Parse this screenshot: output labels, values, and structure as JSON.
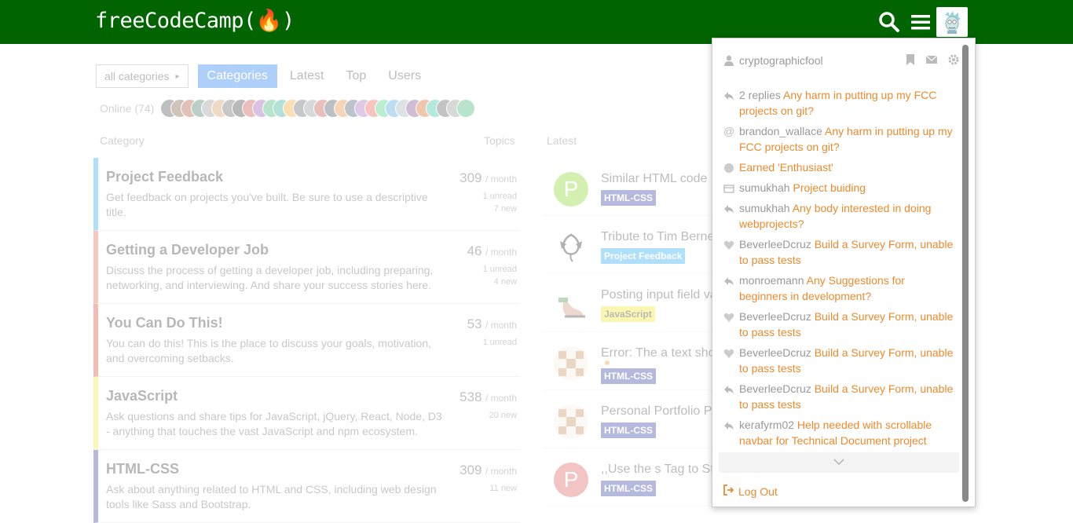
{
  "header": {
    "logo": "freeCodeCamp(🔥)",
    "bg_color": "#006400"
  },
  "nav": {
    "category_dropdown": "all categories",
    "pills": [
      {
        "label": "Categories",
        "active": true
      },
      {
        "label": "Latest",
        "active": false
      },
      {
        "label": "Top",
        "active": false
      },
      {
        "label": "Users",
        "active": false
      }
    ],
    "online_label": "Online (74)"
  },
  "columns": {
    "category": "Category",
    "topics": "Topics",
    "latest": "Latest"
  },
  "categories": [
    {
      "name": "Project Feedback",
      "desc": "Get feedback on projects you've built. Be sure to use a descriptive title.",
      "count": "309",
      "period": "/ month",
      "sub1": "1 unread",
      "sub2": "7 new",
      "color": "#0a6ef4"
    },
    {
      "name": "Getting a Developer Job",
      "desc": "Discuss the process of getting a developer job, including preparing, networking, and interviewing. And share your success stories here.",
      "count": "46",
      "period": "/ month",
      "sub1": "1 unread",
      "sub2": "4 new",
      "color": "#e45735"
    },
    {
      "name": "You Can Do This!",
      "desc": "You can do this! This is the place to discuss your goals, motivation, and overcoming setbacks.",
      "count": "53",
      "period": "/ month",
      "sub1": "1 unread",
      "sub2": "",
      "color": "#e02d18"
    },
    {
      "name": "JavaScript",
      "desc": "Ask questions and share tips for JavaScript, jQuery, React, Node, D3 - anything that touches the vast JavaScript and npm ecosystem.",
      "count": "538",
      "period": "/ month",
      "sub1": "20 new",
      "sub2": "",
      "color": "#f3e813"
    },
    {
      "name": "HTML-CSS",
      "desc": "Ask about anything related to HTML and CSS, including web design tools like Sass and Bootstrap.",
      "count": "309",
      "period": "/ month",
      "sub1": "11 new",
      "sub2": "",
      "color": "#1e2a9c"
    }
  ],
  "latest": [
    {
      "title": "Similar HTML code",
      "tag": "HTML-CSS",
      "tag_color": "#1e2a9c",
      "avatar_letter": "P",
      "avatar_color": "#79d10c"
    },
    {
      "title": "Tribute to Tim Berne",
      "tag": "Project Feedback",
      "tag_color": "#0a9ff0",
      "avatar_letter": "",
      "avatar_color": "#222222"
    },
    {
      "title": "Posting input field va",
      "tag": "JavaScript",
      "tag_color": "#f3e813",
      "avatar_letter": "",
      "avatar_color": "#c8876b"
    },
    {
      "title": "Error: The a text sho",
      "tag": "HTML-CSS",
      "tag_color": "#1e2a9c",
      "avatar_letter": "",
      "avatar_color": "#c4834b"
    },
    {
      "title": "Personal Portfolio P",
      "tag": "HTML-CSS",
      "tag_color": "#1e2a9c",
      "avatar_letter": "",
      "avatar_color": "#c4834b"
    },
    {
      "title": ",,Use the s Tag to St",
      "tag": "HTML-CSS",
      "tag_color": "#1e2a9c",
      "avatar_letter": "P",
      "avatar_color": "#d94c4c"
    }
  ],
  "panel": {
    "username": "cryptographicfool",
    "notifications": [
      {
        "icon": "reply-icon",
        "user": "2 replies",
        "text": "Any harm in putting up my FCC projects on git?"
      },
      {
        "icon": "mention-icon",
        "user": "brandon_wallace",
        "text": "Any harm in putting up my FCC projects on git?"
      },
      {
        "icon": "badge-icon",
        "user": "",
        "text": "Earned 'Enthusiast'"
      },
      {
        "icon": "message-icon",
        "user": "sumukhah",
        "text": "Project buiding"
      },
      {
        "icon": "reply-icon",
        "user": "sumukhah",
        "text": "Any body interested in doing webprojects?"
      },
      {
        "icon": "heart-icon",
        "user": "BeverleeDcruz",
        "text": "Build a Survey Form, unable to pass tests"
      },
      {
        "icon": "reply-icon",
        "user": "monroemann",
        "text": "Any Suggestions for beginners in development?"
      },
      {
        "icon": "heart-icon",
        "user": "BeverleeDcruz",
        "text": "Build a Survey Form, unable to pass tests"
      },
      {
        "icon": "heart-icon",
        "user": "BeverleeDcruz",
        "text": "Build a Survey Form, unable to pass tests"
      },
      {
        "icon": "reply-icon",
        "user": "BeverleeDcruz",
        "text": "Build a Survey Form, unable to pass tests"
      },
      {
        "icon": "reply-icon",
        "user": "kerafyrm02",
        "text": "Help needed with scrollable navbar for Technical Document project"
      }
    ],
    "logout_label": "Log Out",
    "link_color": "#ec8a2d"
  },
  "online_avatar_colors": [
    "#3a3a3a",
    "#6b4c2a",
    "#a04020",
    "#2d6a4f",
    "#8a8a8a",
    "#d18a4a",
    "#555",
    "#2a2a2a",
    "#c0392b",
    "#8e44ad",
    "#27ae60",
    "#16a085",
    "#f39c12",
    "#555",
    "#7f8c8d",
    "#c0392b",
    "#2c3e50",
    "#e67e22",
    "#34495e",
    "#9b59b6",
    "#e74c3c",
    "#2ecc71",
    "#3498db",
    "#95a5a6",
    "#6c3483",
    "#d35400",
    "#1abc9c",
    "#4a4a4a",
    "#888",
    "#27ae60"
  ]
}
